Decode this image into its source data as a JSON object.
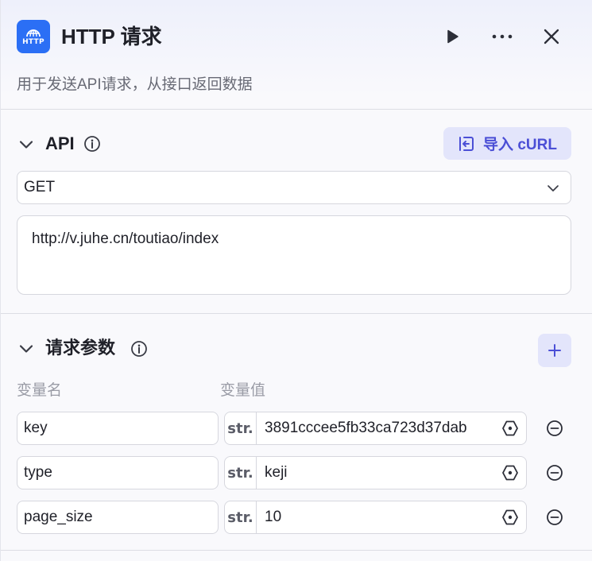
{
  "header": {
    "logo_text": "HTTP",
    "title": "HTTP 请求",
    "description": "用于发送API请求，从接口返回数据",
    "icons": {
      "run": "play-icon",
      "more": "more-icon",
      "close": "close-icon"
    }
  },
  "api": {
    "title": "API",
    "import_label": "导入 cURL",
    "method": "GET",
    "url": "http://v.juhe.cn/toutiao/index"
  },
  "params": {
    "title": "请求参数",
    "col_name": "变量名",
    "col_value": "变量值",
    "rows": [
      {
        "name": "key",
        "type": "str.",
        "value": "3891cccee5fb33ca723d37dab"
      },
      {
        "name": "type",
        "type": "str.",
        "value": "keji"
      },
      {
        "name": "page_size",
        "type": "str.",
        "value": "10"
      }
    ]
  },
  "colors": {
    "accent": "#4b4fd6",
    "logo": "#2b6ff5",
    "button_bg": "#e3e5fb"
  }
}
